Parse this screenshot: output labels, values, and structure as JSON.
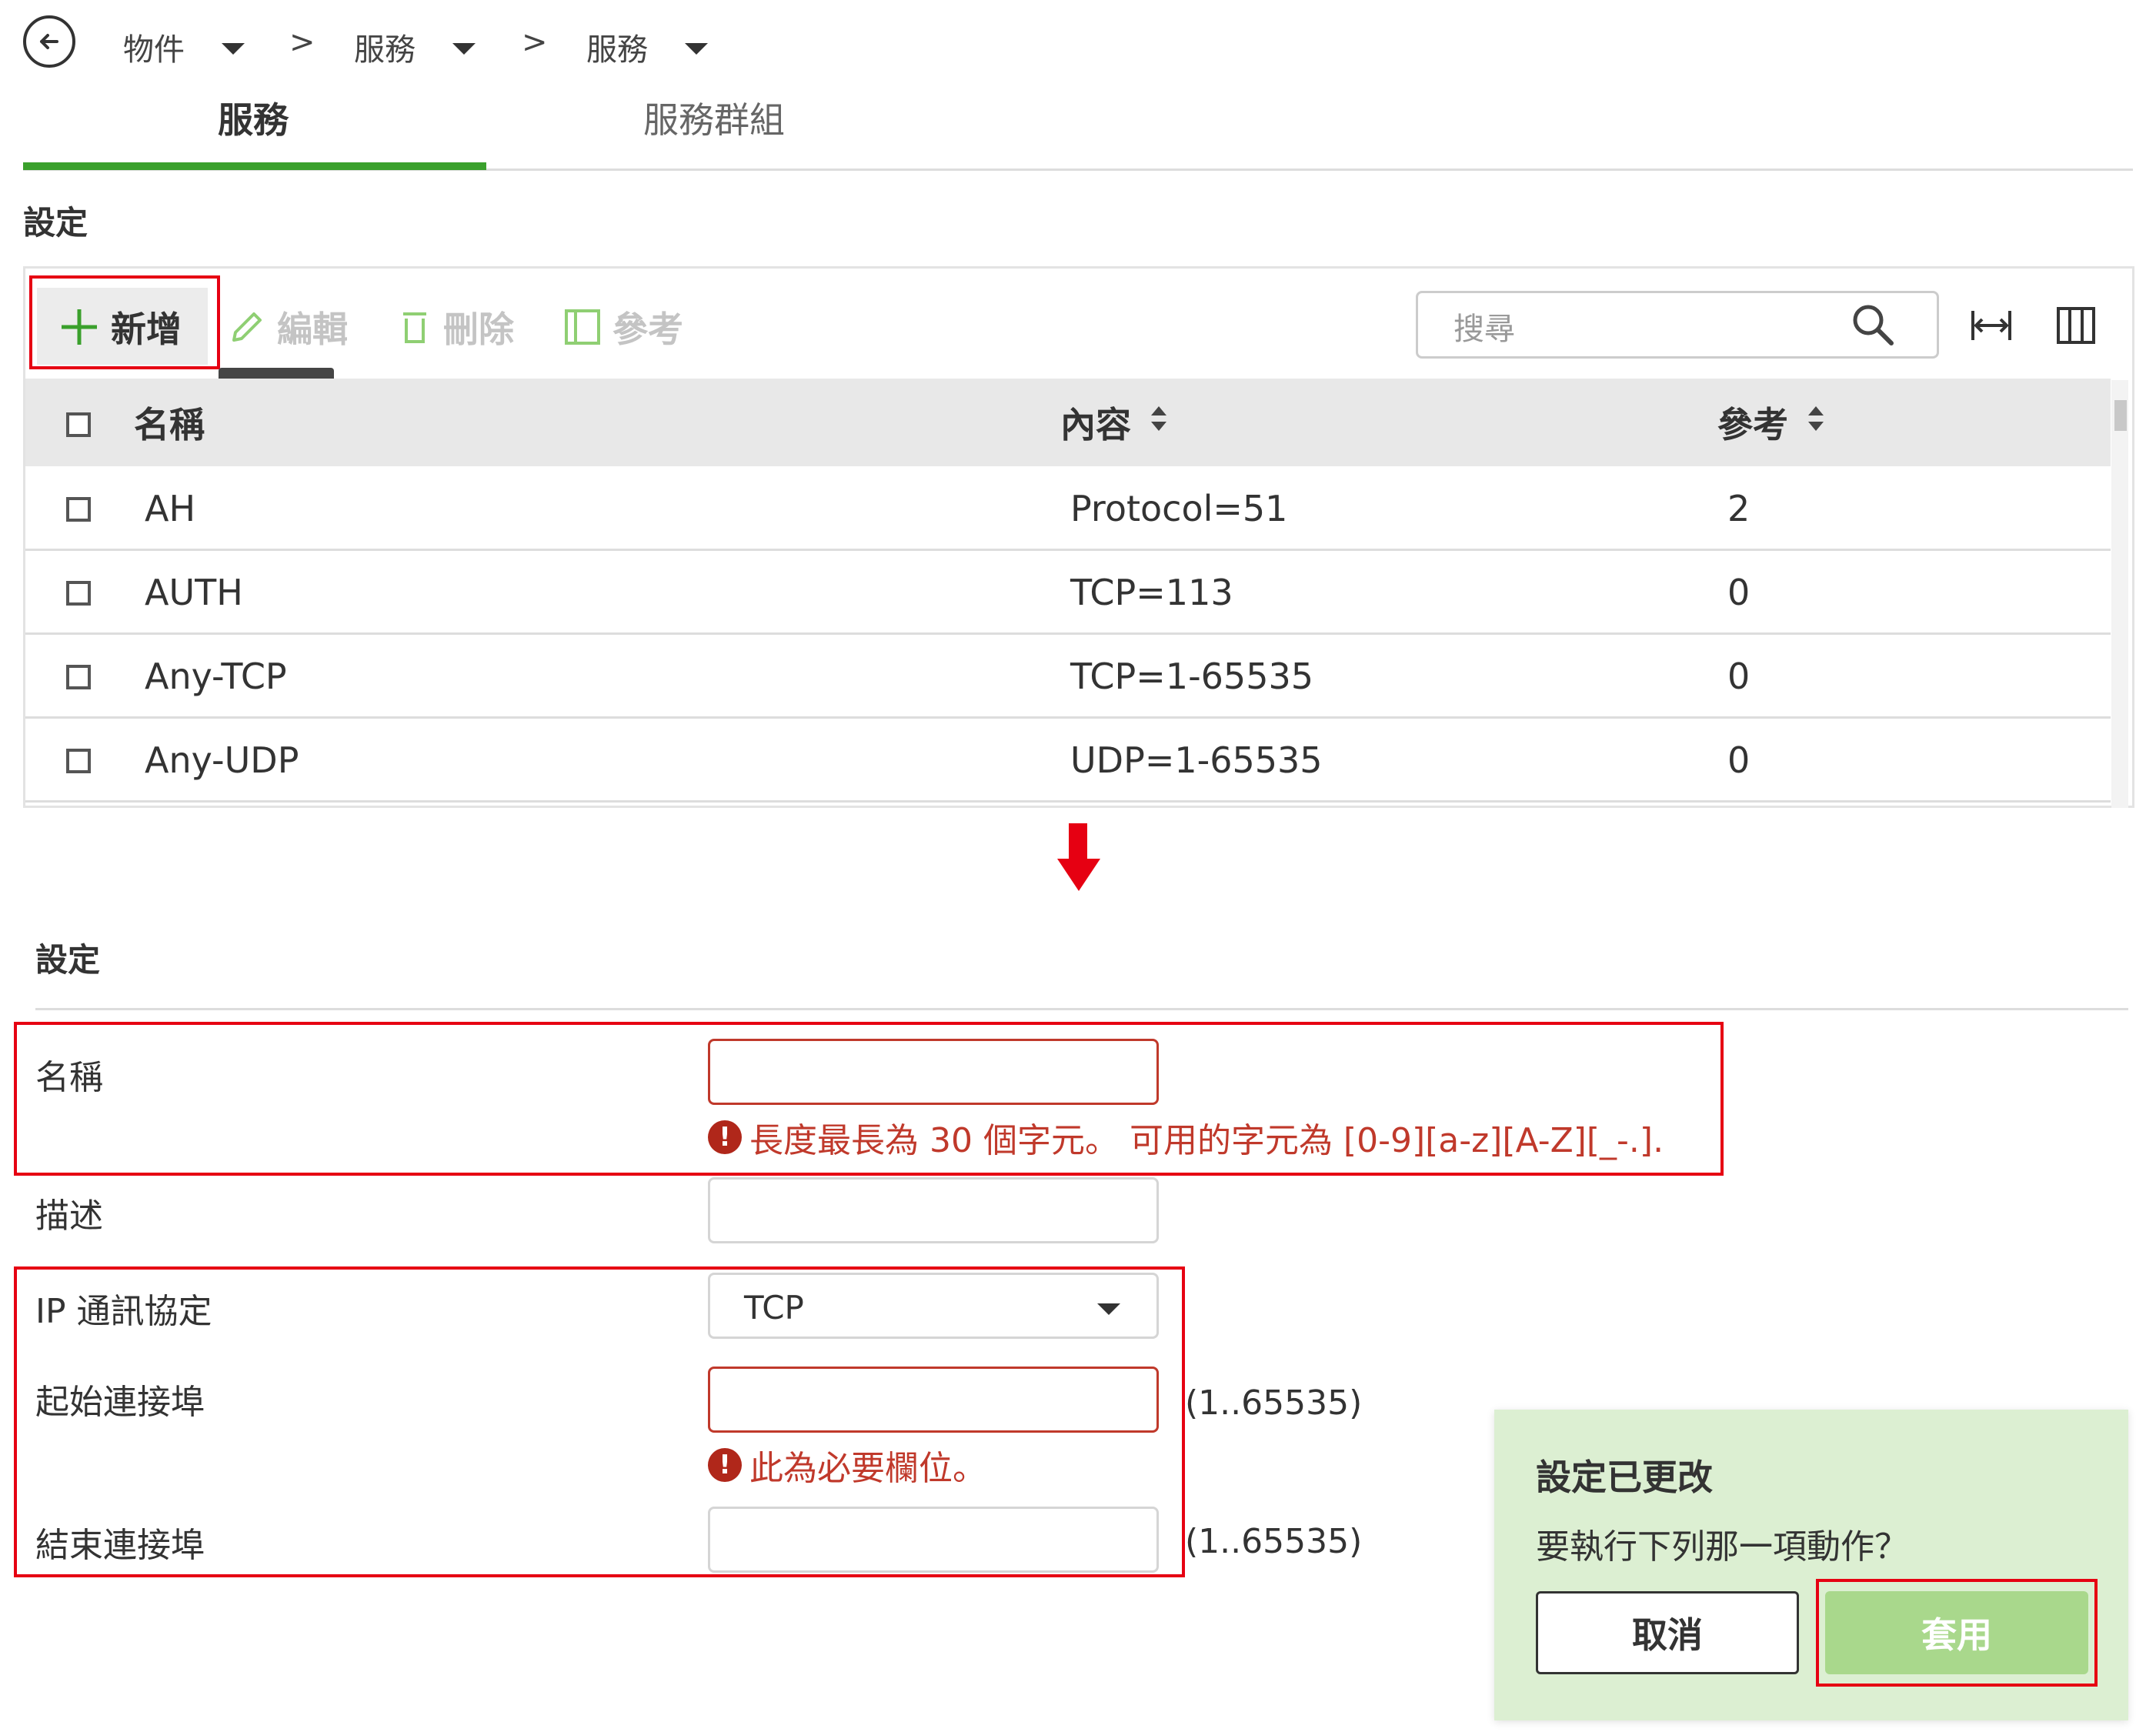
{
  "breadcrumb": {
    "items": [
      "物件",
      "服務",
      "服務"
    ],
    "separator": ">"
  },
  "tabs": [
    {
      "label": "服務",
      "active": true
    },
    {
      "label": "服務群組",
      "active": false
    }
  ],
  "section_title": "設定",
  "toolbar": {
    "add_label": "新增",
    "edit_label": "編輯",
    "delete_label": "刪除",
    "reference_label": "參考",
    "search_placeholder": "搜尋",
    "tooltip": "新增"
  },
  "table": {
    "columns": [
      "名稱",
      "內容",
      "參考"
    ],
    "rows": [
      {
        "name": "AH",
        "content": "Protocol=51",
        "ref": "2"
      },
      {
        "name": "AUTH",
        "content": "TCP=113",
        "ref": "0"
      },
      {
        "name": "Any-TCP",
        "content": "TCP=1-65535",
        "ref": "0"
      },
      {
        "name": "Any-UDP",
        "content": "UDP=1-65535",
        "ref": "0"
      }
    ]
  },
  "form": {
    "title": "設定",
    "name_label": "名稱",
    "name_value": "",
    "name_error": "長度最長為 30 個字元。 可用的字元為 [0-9][a-z][A-Z][_-.].",
    "desc_label": "描述",
    "desc_value": "",
    "protocol_label": "IP 通訊協定",
    "protocol_value": "TCP",
    "start_port_label": "起始連接埠",
    "start_port_value": "",
    "start_port_range": "(1..65535)",
    "start_port_error": "此為必要欄位。",
    "end_port_label": "結束連接埠",
    "end_port_value": "",
    "end_port_range": "(1..65535)"
  },
  "dialog": {
    "title": "設定已更改",
    "message": "要執行下列那一項動作？",
    "cancel_label": "取消",
    "apply_label": "套用"
  },
  "colors": {
    "accent_green": "#3aa02c",
    "highlight_red": "#e60012",
    "error_red": "#c0392b",
    "dialog_bg": "#dcefd2",
    "apply_bg": "#a9d88c"
  },
  "icons": [
    "back-arrow-icon",
    "caret-down-icon",
    "plus-icon",
    "pencil-icon",
    "trash-icon",
    "reference-icon",
    "search-icon",
    "fit-width-icon",
    "columns-icon",
    "sort-icon",
    "error-icon",
    "down-arrow-icon"
  ]
}
